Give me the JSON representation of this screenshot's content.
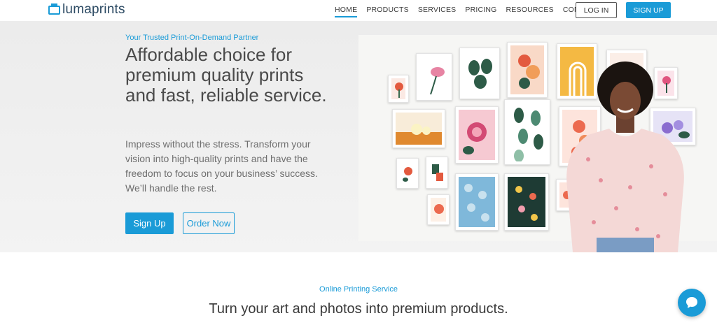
{
  "brand": {
    "name": "lumaprints",
    "accent": "#1a9bd7"
  },
  "nav": {
    "links": [
      {
        "label": "HOME",
        "active": true
      },
      {
        "label": "PRODUCTS"
      },
      {
        "label": "SERVICES"
      },
      {
        "label": "PRICING"
      },
      {
        "label": "RESOURCES"
      },
      {
        "label": "CONTACT"
      }
    ],
    "login_label": "LOG IN",
    "signup_label": "SIGN UP"
  },
  "hero": {
    "eyebrow": "Your Trusted Print-On-Demand Partner",
    "title": "Affordable choice for premium quality prints and fast, reliable service.",
    "description": "Impress without the stress. Transform your vision into high-quality prints and have the freedom to focus on your business’ success. We’ll handle the rest.",
    "signup_label": "Sign Up",
    "order_label": "Order Now"
  },
  "section2": {
    "eyebrow": "Online Printing Service",
    "title": "Turn your art and photos into premium products."
  },
  "icons": {
    "logo": "logo-frame-icon",
    "chat": "chat-bubble-icon"
  }
}
